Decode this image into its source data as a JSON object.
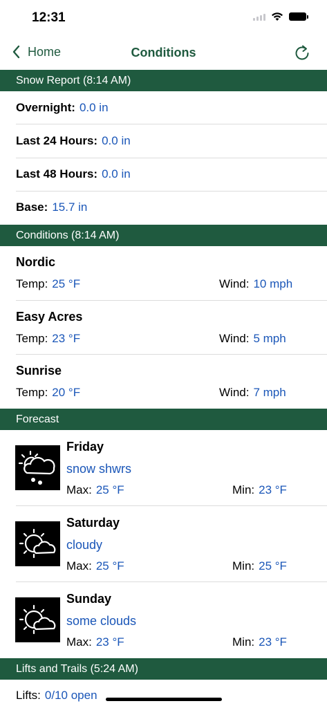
{
  "status": {
    "time": "12:31"
  },
  "nav": {
    "back_label": "Home",
    "title": "Conditions"
  },
  "snow": {
    "header": "Snow Report (8:14 AM)",
    "rows": [
      {
        "label": "Overnight:",
        "value": "0.0 in"
      },
      {
        "label": "Last 24 Hours:",
        "value": "0.0 in"
      },
      {
        "label": "Last 48 Hours:",
        "value": "0.0 in"
      },
      {
        "label": "Base:",
        "value": "15.7 in"
      }
    ]
  },
  "conditions": {
    "header": "Conditions (8:14 AM)",
    "temp_label": "Temp:",
    "wind_label": "Wind:",
    "items": [
      {
        "name": "Nordic",
        "temp": "25 °F",
        "wind": "10 mph"
      },
      {
        "name": "Easy Acres",
        "temp": "23 °F",
        "wind": "5 mph"
      },
      {
        "name": "Sunrise",
        "temp": "20 °F",
        "wind": "7 mph"
      }
    ]
  },
  "forecast": {
    "header": "Forecast",
    "max_label": "Max:",
    "min_label": "Min:",
    "days": [
      {
        "day": "Friday",
        "desc": "snow shwrs",
        "max": "25 °F",
        "min": "23 °F",
        "icon": "snow-showers-icon"
      },
      {
        "day": "Saturday",
        "desc": "cloudy",
        "max": "25 °F",
        "min": "25 °F",
        "icon": "partly-cloudy-icon"
      },
      {
        "day": "Sunday",
        "desc": "some clouds",
        "max": "23 °F",
        "min": "23 °F",
        "icon": "partly-cloudy-icon"
      }
    ]
  },
  "lifts": {
    "header": "Lifts and Trails (5:24 AM)",
    "lifts_label": "Lifts:",
    "lifts_value": "0/10 open"
  },
  "colors": {
    "brand_green": "#1f5a3f",
    "value_blue": "#1a56b8"
  }
}
